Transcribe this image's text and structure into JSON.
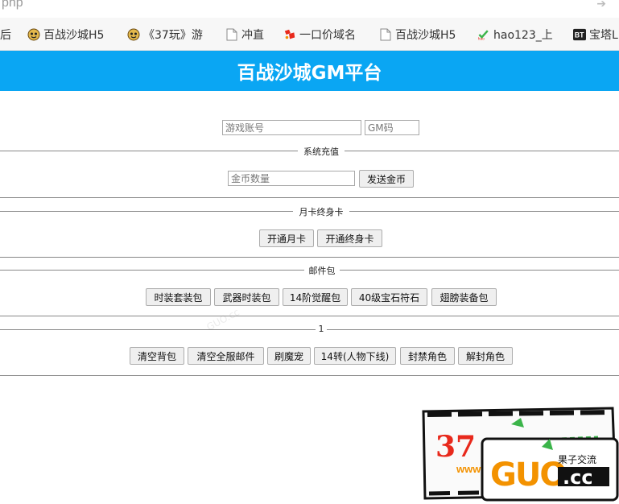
{
  "browser": {
    "url_fragment": "php",
    "bookmarks": [
      {
        "label": "后",
        "icon": "none"
      },
      {
        "label": "百战沙城H5",
        "icon": "smiley-icon"
      },
      {
        "label": "《37玩》游",
        "icon": "smiley-icon"
      },
      {
        "label": "冲直",
        "icon": "page-icon"
      },
      {
        "label": "一口价域名",
        "icon": "brand-icon"
      },
      {
        "label": "百战沙城H5",
        "icon": "page-icon"
      },
      {
        "label": "hao123_上",
        "icon": "hao123-icon"
      },
      {
        "label": "宝塔L",
        "icon": "bt-icon"
      }
    ]
  },
  "app": {
    "title": "百战沙城GM平台"
  },
  "account": {
    "account_placeholder": "游戏账号",
    "gm_placeholder": "GM码"
  },
  "sections": {
    "recharge": {
      "legend": "系统充值",
      "coin_placeholder": "金币数量",
      "send_label": "发送金币"
    },
    "card": {
      "legend": "月卡终身卡",
      "buttons": [
        "开通月卡",
        "开通终身卡"
      ]
    },
    "mail": {
      "legend": "邮件包",
      "buttons": [
        "时装套装包",
        "武器时装包",
        "14阶觉醒包",
        "40级宝石符石",
        "翅膀装备包"
      ]
    },
    "misc": {
      "legend": "1",
      "buttons": [
        "清空背包",
        "清空全服邮件",
        "刷魔宠",
        "14转(人物下线)",
        "封禁角色",
        "解封角色"
      ]
    }
  },
  "watermark": {
    "number": "37",
    "url_text": "www",
    "site": "GUO.cc",
    "tagline": "果子交流"
  },
  "colors": {
    "header_bg": "#0aa6f3",
    "header_text": "#ffffff",
    "stamp_red": "#e8291c",
    "stamp_orange": "#f39200"
  }
}
